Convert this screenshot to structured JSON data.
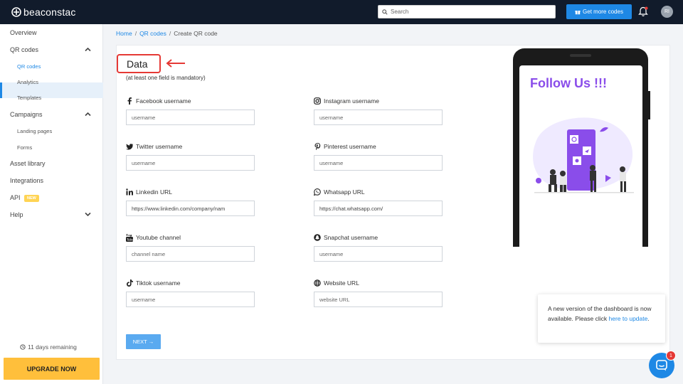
{
  "brand": {
    "name": "beaconstac",
    "accent": "#1e88e5"
  },
  "topbar": {
    "search_placeholder": "Search",
    "get_more_label": "Get more codes",
    "avatar_initials": "RI"
  },
  "sidebar": {
    "overview": "Overview",
    "qr_codes": "QR codes",
    "qr_codes_sub": "QR codes",
    "analytics": "Analytics",
    "templates": "Templates",
    "campaigns": "Campaigns",
    "landing_pages": "Landing pages",
    "forms": "Forms",
    "asset_library": "Asset library",
    "integrations": "Integrations",
    "api": "API",
    "api_badge": "NEW",
    "help": "Help",
    "days_remaining": "11 days remaining",
    "upgrade": "UPGRADE NOW"
  },
  "breadcrumb": {
    "home": "Home",
    "qr_codes": "QR codes",
    "current": "Create QR code"
  },
  "form": {
    "title": "Data",
    "subtitle": "(at least one field is mandatory)",
    "fields": {
      "facebook": {
        "label": "Facebook username",
        "placeholder": "username",
        "icon": "facebook-icon"
      },
      "instagram": {
        "label": "Instagram username",
        "placeholder": "username",
        "icon": "instagram-icon"
      },
      "twitter": {
        "label": "Twitter username",
        "placeholder": "username",
        "icon": "twitter-icon"
      },
      "pinterest": {
        "label": "Pinterest username",
        "placeholder": "username",
        "icon": "pinterest-icon"
      },
      "linkedin": {
        "label": "Linkedin URL",
        "value": "https://www.linkedin.com/company/nam",
        "icon": "linkedin-icon"
      },
      "whatsapp": {
        "label": "Whatsapp URL",
        "value": "https://chat.whatsapp.com/",
        "icon": "whatsapp-icon"
      },
      "youtube": {
        "label": "Youtube channel",
        "placeholder": "channel name",
        "icon": "youtube-icon"
      },
      "snapchat": {
        "label": "Snapchat username",
        "placeholder": "username",
        "icon": "snapchat-icon"
      },
      "tiktok": {
        "label": "Tiktok username",
        "placeholder": "username",
        "icon": "tiktok-icon"
      },
      "website": {
        "label": "Website URL",
        "placeholder": "website URL",
        "icon": "globe-icon"
      }
    },
    "next_label": "NEXT →"
  },
  "preview": {
    "headline": "Follow Us !!!",
    "headline_color": "#8a4dea"
  },
  "popup": {
    "text": "A new version of the dashboard is now available. Please click ",
    "link": "here to update",
    "end": "."
  },
  "chat": {
    "badge_count": "1"
  }
}
